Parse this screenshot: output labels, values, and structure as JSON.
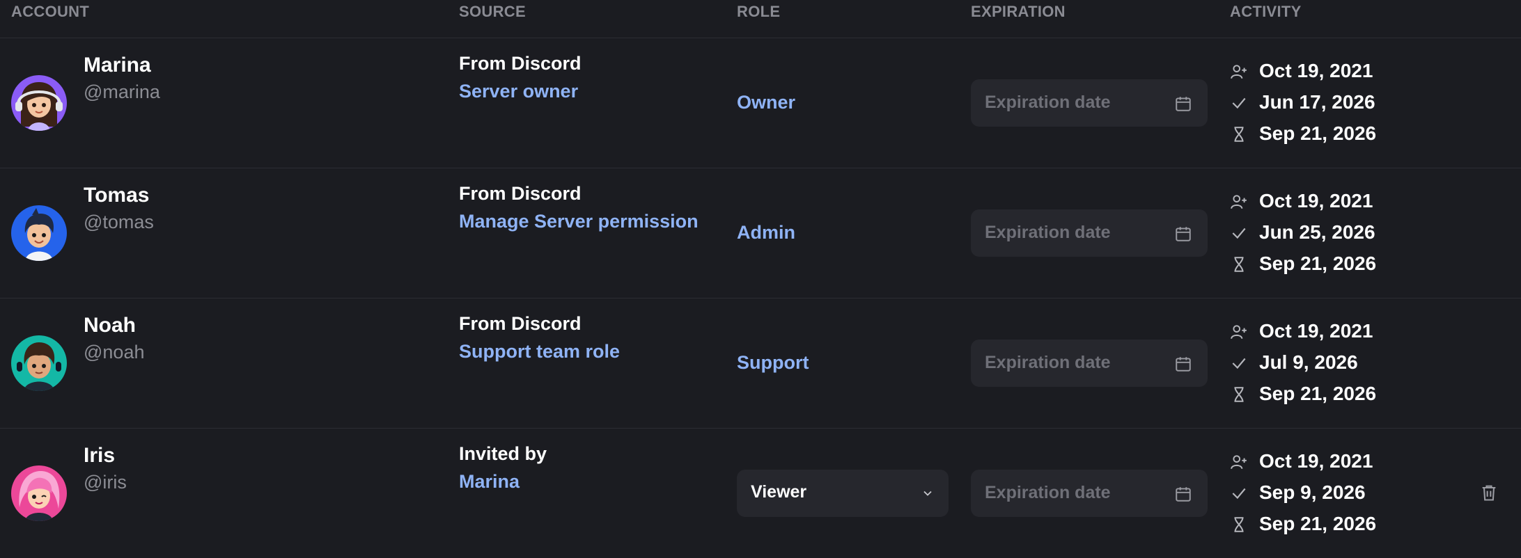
{
  "columns": {
    "account": "ACCOUNT",
    "source": "SOURCE",
    "role": "ROLE",
    "expiration": "EXPIRATION",
    "activity": "ACTIVITY"
  },
  "expiration_placeholder": "Expiration date",
  "colors": {
    "background": "#1b1c21",
    "link": "#8fb3f5",
    "muted": "#8c8d94",
    "field": "#26272d"
  },
  "icons": {
    "joined": "user-plus-icon",
    "verified": "check-icon",
    "expires": "hourglass-icon",
    "calendar": "calendar-icon",
    "delete": "trash-icon",
    "dropdown": "chevron-down-icon"
  },
  "rows": [
    {
      "name": "Marina",
      "handle": "@marina",
      "source_title": "From Discord",
      "source_detail": "Server owner",
      "role": "Owner",
      "activity": [
        "Oct 19, 2021",
        "Jun 17, 2026",
        "Sep 21, 2026"
      ]
    },
    {
      "name": "Tomas",
      "handle": "@tomas",
      "source_title": "From Discord",
      "source_detail": "Manage Server permission",
      "role": "Admin",
      "activity": [
        "Oct 19, 2021",
        "Jun 25, 2026",
        "Sep 21, 2026"
      ]
    },
    {
      "name": "Noah",
      "handle": "@noah",
      "source_title": "From Discord",
      "source_detail": "Support team role",
      "role": "Support",
      "activity": [
        "Oct 19, 2021",
        "Jul 9, 2026",
        "Sep 21, 2026"
      ]
    },
    {
      "name": "Iris",
      "handle": "@iris",
      "source_title": "Invited by",
      "source_detail": "Marina",
      "role": "Viewer",
      "activity": [
        "Oct 19, 2021",
        "Sep 9, 2026",
        "Sep 21, 2026"
      ]
    }
  ]
}
